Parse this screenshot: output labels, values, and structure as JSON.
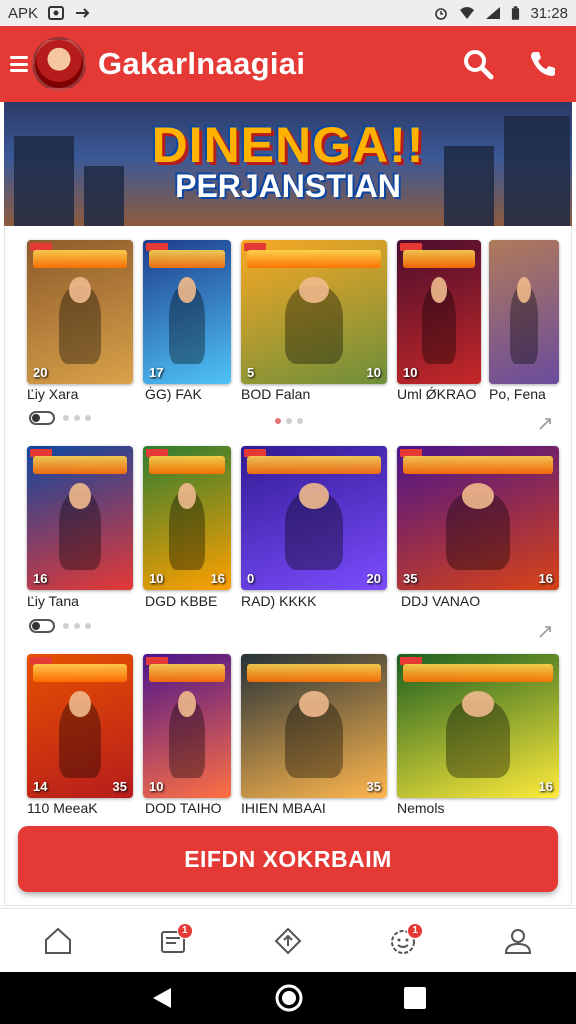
{
  "status_bar": {
    "left_text": "APK",
    "time": "31:28",
    "icons": [
      "image-icon",
      "send-icon",
      "alarm-icon",
      "wifi-icon",
      "signal-icon",
      "battery-icon"
    ]
  },
  "app_bar": {
    "title": "Gakarlnaagiai",
    "icons": [
      "menu-icon",
      "avatar",
      "search-icon",
      "phone-icon"
    ],
    "color": "#e53935"
  },
  "banner": {
    "title": "DINENGA!!",
    "subtitle": "PERJANSTIAN"
  },
  "rows": [
    {
      "cards": [
        {
          "label": "Ľiy Xara",
          "num": "20",
          "num2": "",
          "colors": [
            "#8d5a2b",
            "#d9a24a"
          ]
        },
        {
          "label": "ĠG) FAK",
          "num": "17",
          "num2": "",
          "colors": [
            "#1e3c8c",
            "#4fc3f7"
          ]
        },
        {
          "label": "BOD Falan",
          "num": "5",
          "num2": "10",
          "colors": [
            "#f9a825",
            "#6d8f3a"
          ]
        },
        {
          "label": "Uml ǾKRAO",
          "num": "10",
          "num2": "",
          "colors": [
            "#4a0e2e",
            "#c62828"
          ]
        },
        {
          "label": "Po, Fena",
          "num": "",
          "num2": "",
          "colors": [
            "#b07a5a",
            "#6a4c9c"
          ]
        }
      ],
      "active_dot_index": -1
    },
    {
      "cards": [
        {
          "label": "Ľiy Tana",
          "num": "16",
          "num2": "",
          "colors": [
            "#0d47a1",
            "#e53935"
          ]
        },
        {
          "label": "DGD KBBE",
          "num": "10",
          "num2": "16",
          "colors": [
            "#2e7d32",
            "#ffa000"
          ]
        },
        {
          "label": "RAD) KKKK",
          "num": "0",
          "num2": "20",
          "colors": [
            "#311b92",
            "#7c4dff"
          ]
        },
        {
          "label": "DDJ VANAO",
          "num": "35",
          "num2": "16",
          "colors": [
            "#4a148c",
            "#d84315"
          ]
        }
      ],
      "active_dot_index": -1
    },
    {
      "cards": [
        {
          "label": "110 MeeaK",
          "num": "14",
          "num2": "35",
          "colors": [
            "#e65100",
            "#b71c1c"
          ]
        },
        {
          "label": "DOD TAIHO",
          "num": "10",
          "num2": "",
          "colors": [
            "#4a148c",
            "#ff7043"
          ]
        },
        {
          "label": "IHIEN MBAAI",
          "num": "",
          "num2": "35",
          "colors": [
            "#263238",
            "#ffb74d"
          ]
        },
        {
          "label": "Nemols",
          "num": "",
          "num2": "16",
          "colors": [
            "#1b5e20",
            "#ffeb3b"
          ]
        }
      ],
      "active_dot_index": -1
    }
  ],
  "second_row_dots_active": 0,
  "cta": {
    "label": "EIFDN XOKRBAIM"
  },
  "bottom_nav": [
    {
      "icon": "home-icon",
      "badge": ""
    },
    {
      "icon": "inbox-icon",
      "badge": "1"
    },
    {
      "icon": "upload-icon",
      "badge": ""
    },
    {
      "icon": "friends-icon",
      "badge": "1"
    },
    {
      "icon": "profile-icon",
      "badge": ""
    }
  ],
  "system_nav": [
    "back-icon",
    "home-circle-icon",
    "recents-icon"
  ]
}
